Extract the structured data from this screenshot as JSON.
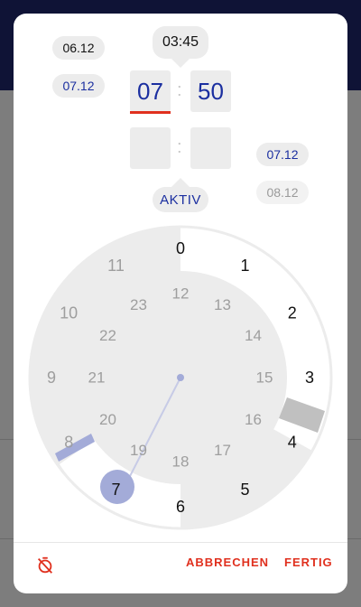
{
  "dialog": {
    "start_date_top": "06.12",
    "start_date_selected": "07.12",
    "duration_label": "03:45",
    "hour_value": "07",
    "minute_value": "50",
    "end_hour_value": "",
    "end_minute_value": "",
    "end_date_selected": "07.12",
    "end_date_next": "08.12",
    "status_label": "AKTIV",
    "clock": {
      "outer_numbers": [
        "0",
        "1",
        "2",
        "3",
        "4",
        "5",
        "6",
        "7",
        "8",
        "9",
        "10",
        "11"
      ],
      "inner_numbers": [
        "12",
        "13",
        "14",
        "15",
        "16",
        "17",
        "18",
        "19",
        "20",
        "21",
        "22",
        "23"
      ],
      "selected_hour": "7"
    },
    "footer": {
      "cancel_label": "ABBRECHEN",
      "done_label": "FERTIG"
    },
    "colors": {
      "accent_blue": "#1b2fa0",
      "accent_red": "#e0301e",
      "selection_circle": "#a3abd8"
    }
  }
}
